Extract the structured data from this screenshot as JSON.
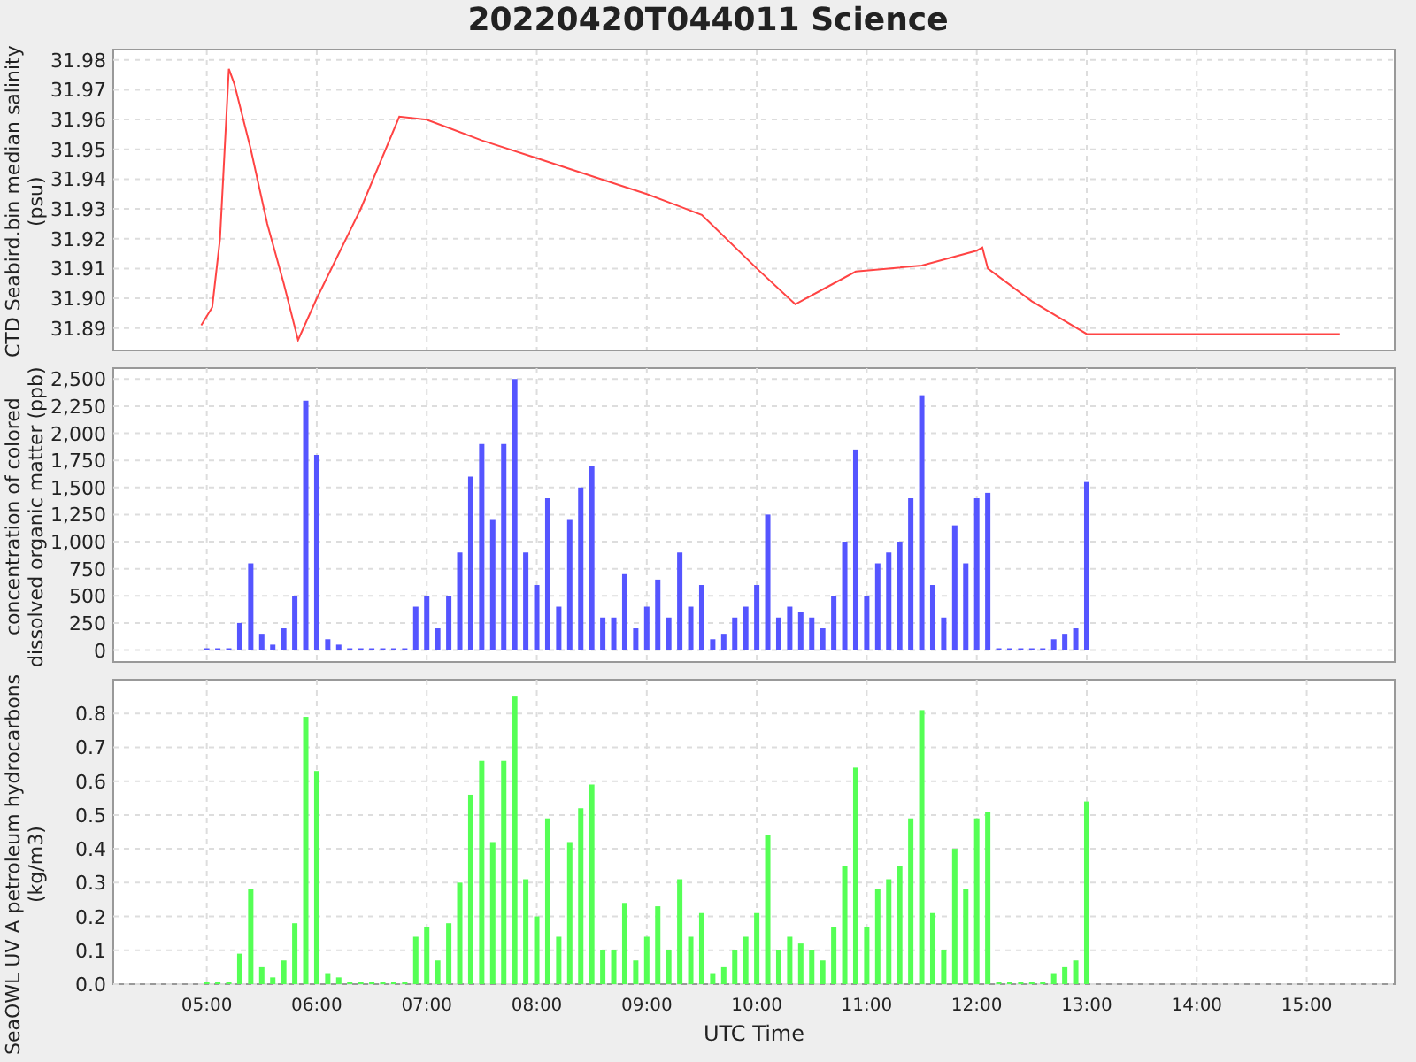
{
  "title": "20220420T044011 Science",
  "panels": [
    {
      "chart_data": {
        "type": "line",
        "ylabel": "CTD Seabird.bin median salinity (psu)",
        "xlim": [
          4.15,
          15.8
        ],
        "ylim": [
          31.8825,
          31.9835
        ],
        "yticks": [
          {
            "value": 31.89,
            "label": "31.89"
          },
          {
            "value": 31.9,
            "label": "31.90"
          },
          {
            "value": 31.91,
            "label": "31.91"
          },
          {
            "value": 31.92,
            "label": "31.92"
          },
          {
            "value": 31.93,
            "label": "31.93"
          },
          {
            "value": 31.94,
            "label": "31.94"
          },
          {
            "value": 31.95,
            "label": "31.95"
          },
          {
            "value": 31.96,
            "label": "31.96"
          },
          {
            "value": 31.97,
            "label": "31.97"
          },
          {
            "value": 31.98,
            "label": "31.98"
          }
        ],
        "x": [
          4.95,
          5.05,
          5.12,
          5.2,
          5.25,
          5.4,
          5.55,
          5.7,
          5.83,
          6.0,
          6.4,
          6.75,
          7.0,
          7.5,
          8.0,
          8.5,
          9.0,
          9.5,
          10.0,
          10.35,
          10.6,
          10.9,
          11.5,
          12.0,
          12.05,
          12.1,
          12.5,
          13.0,
          14.0,
          15.3
        ],
        "grid": true,
        "series": [
          {
            "color": "#ff4444",
            "values": [
              31.891,
              31.897,
              31.92,
              31.977,
              31.972,
              31.95,
              31.925,
              31.905,
              31.886,
              31.9,
              31.93,
              31.961,
              31.96,
              31.953,
              31.947,
              31.941,
              31.935,
              31.928,
              31.91,
              31.898,
              31.903,
              31.909,
              31.911,
              31.916,
              31.917,
              31.91,
              31.899,
              31.888,
              31.888,
              31.888
            ]
          }
        ]
      }
    },
    {
      "chart_data": {
        "type": "bar",
        "ylabel": "concentration of colored dissolved organic matter (ppb)",
        "xlim": [
          4.15,
          15.8
        ],
        "ylim": [
          -110,
          2600
        ],
        "yticks": [
          {
            "value": 0,
            "label": "0"
          },
          {
            "value": 250,
            "label": "250"
          },
          {
            "value": 500,
            "label": "500"
          },
          {
            "value": 750,
            "label": "750"
          },
          {
            "value": 1000,
            "label": "1,000"
          },
          {
            "value": 1250,
            "label": "1,250"
          },
          {
            "value": 1500,
            "label": "1,500"
          },
          {
            "value": 1750,
            "label": "1,750"
          },
          {
            "value": 2000,
            "label": "2,000"
          },
          {
            "value": 2250,
            "label": "2,250"
          },
          {
            "value": 2500,
            "label": "2,500"
          }
        ],
        "x": [
          5.0,
          5.1,
          5.2,
          5.3,
          5.4,
          5.5,
          5.6,
          5.7,
          5.8,
          5.9,
          6.0,
          6.1,
          6.2,
          6.3,
          6.4,
          6.5,
          6.6,
          6.7,
          6.8,
          6.9,
          7.0,
          7.1,
          7.2,
          7.3,
          7.4,
          7.5,
          7.6,
          7.7,
          7.8,
          7.9,
          8.0,
          8.1,
          8.2,
          8.3,
          8.4,
          8.5,
          8.6,
          8.7,
          8.8,
          8.9,
          9.0,
          9.1,
          9.2,
          9.3,
          9.4,
          9.5,
          9.6,
          9.7,
          9.8,
          9.9,
          10.0,
          10.1,
          10.2,
          10.3,
          10.4,
          10.5,
          10.6,
          10.7,
          10.8,
          10.9,
          11.0,
          11.1,
          11.2,
          11.3,
          11.4,
          11.5,
          11.6,
          11.7,
          11.8,
          11.9,
          12.0,
          12.1,
          12.2,
          12.3,
          12.4,
          12.5,
          12.6,
          12.7,
          12.8,
          12.9,
          13.0
        ],
        "grid": true,
        "series": [
          {
            "color": "#5555ff",
            "values": [
              0,
              0,
              0,
              250,
              800,
              150,
              50,
              200,
              500,
              2300,
              1800,
              100,
              50,
              0,
              0,
              0,
              0,
              0,
              0,
              400,
              500,
              200,
              500,
              900,
              1600,
              1900,
              1200,
              1900,
              2500,
              900,
              600,
              1400,
              400,
              1200,
              1500,
              1700,
              300,
              300,
              700,
              200,
              400,
              650,
              300,
              900,
              400,
              600,
              100,
              150,
              300,
              400,
              600,
              1250,
              300,
              400,
              350,
              300,
              200,
              500,
              1000,
              1850,
              500,
              800,
              900,
              1000,
              1400,
              2350,
              600,
              300,
              1150,
              800,
              1400,
              1450,
              0,
              0,
              0,
              0,
              0,
              100,
              150,
              200,
              1550
            ]
          }
        ]
      }
    },
    {
      "chart_data": {
        "type": "bar",
        "xlabel": "UTC Time",
        "ylabel": "SeaOWL UV A petroleum hydrocarbons (kg/m3)",
        "xlim": [
          4.15,
          15.8
        ],
        "ylim": [
          0,
          0.9
        ],
        "xticks": [
          {
            "value": 5,
            "label": "05:00"
          },
          {
            "value": 6,
            "label": "06:00"
          },
          {
            "value": 7,
            "label": "07:00"
          },
          {
            "value": 8,
            "label": "08:00"
          },
          {
            "value": 9,
            "label": "09:00"
          },
          {
            "value": 10,
            "label": "10:00"
          },
          {
            "value": 11,
            "label": "11:00"
          },
          {
            "value": 12,
            "label": "12:00"
          },
          {
            "value": 13,
            "label": "13:00"
          },
          {
            "value": 14,
            "label": "14:00"
          },
          {
            "value": 15,
            "label": "15:00"
          }
        ],
        "yticks": [
          {
            "value": 0,
            "label": "0.0"
          },
          {
            "value": 0.1,
            "label": "0.1"
          },
          {
            "value": 0.2,
            "label": "0.2"
          },
          {
            "value": 0.3,
            "label": "0.3"
          },
          {
            "value": 0.4,
            "label": "0.4"
          },
          {
            "value": 0.5,
            "label": "0.5"
          },
          {
            "value": 0.6,
            "label": "0.6"
          },
          {
            "value": 0.7,
            "label": "0.7"
          },
          {
            "value": 0.8,
            "label": "0.8"
          }
        ],
        "x": [
          5.0,
          5.1,
          5.2,
          5.3,
          5.4,
          5.5,
          5.6,
          5.7,
          5.8,
          5.9,
          6.0,
          6.1,
          6.2,
          6.3,
          6.4,
          6.5,
          6.6,
          6.7,
          6.8,
          6.9,
          7.0,
          7.1,
          7.2,
          7.3,
          7.4,
          7.5,
          7.6,
          7.7,
          7.8,
          7.9,
          8.0,
          8.1,
          8.2,
          8.3,
          8.4,
          8.5,
          8.6,
          8.7,
          8.8,
          8.9,
          9.0,
          9.1,
          9.2,
          9.3,
          9.4,
          9.5,
          9.6,
          9.7,
          9.8,
          9.9,
          10.0,
          10.1,
          10.2,
          10.3,
          10.4,
          10.5,
          10.6,
          10.7,
          10.8,
          10.9,
          11.0,
          11.1,
          11.2,
          11.3,
          11.4,
          11.5,
          11.6,
          11.7,
          11.8,
          11.9,
          12.0,
          12.1,
          12.2,
          12.3,
          12.4,
          12.5,
          12.6,
          12.7,
          12.8,
          12.9,
          13.0
        ],
        "grid": true,
        "series": [
          {
            "color": "#55ff55",
            "values": [
              0,
              0,
              0,
              0.09,
              0.28,
              0.05,
              0.02,
              0.07,
              0.18,
              0.79,
              0.63,
              0.03,
              0.02,
              0,
              0,
              0,
              0,
              0,
              0,
              0.14,
              0.17,
              0.07,
              0.18,
              0.3,
              0.56,
              0.66,
              0.42,
              0.66,
              0.85,
              0.31,
              0.2,
              0.49,
              0.14,
              0.42,
              0.52,
              0.59,
              0.1,
              0.1,
              0.24,
              0.07,
              0.14,
              0.23,
              0.1,
              0.31,
              0.14,
              0.21,
              0.03,
              0.05,
              0.1,
              0.14,
              0.21,
              0.44,
              0.1,
              0.14,
              0.12,
              0.1,
              0.07,
              0.17,
              0.35,
              0.64,
              0.17,
              0.28,
              0.31,
              0.35,
              0.49,
              0.81,
              0.21,
              0.1,
              0.4,
              0.28,
              0.49,
              0.51,
              0,
              0,
              0,
              0,
              0,
              0.03,
              0.05,
              0.07,
              0.54
            ]
          }
        ]
      }
    }
  ]
}
